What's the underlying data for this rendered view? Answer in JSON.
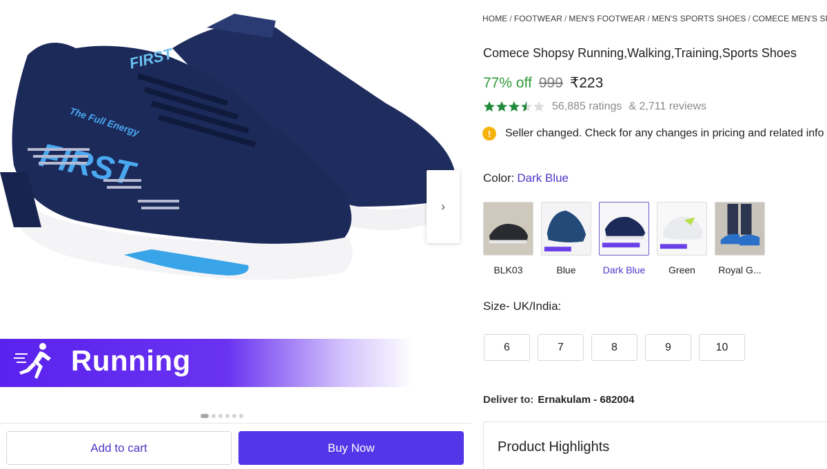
{
  "gallery": {
    "banner_text": "Running",
    "next_icon": "chevron-right-icon",
    "dot_count": 6,
    "active_dot": 0,
    "shoe_print_text": "FIRST",
    "shoe_tagline": "The Full Energy"
  },
  "actions": {
    "add_to_cart": "Add to cart",
    "buy_now": "Buy Now"
  },
  "breadcrumb": [
    "HOME",
    "FOOTWEAR",
    "MEN'S FOOTWEAR",
    "MEN'S SPORTS SHOES",
    "COMECE MEN'S SP"
  ],
  "product": {
    "title": "Comece Shopsy Running,Walking,Training,Sports Shoes",
    "discount": "77% off",
    "mrp": "999",
    "price": "₹223",
    "rating_stars": 3.5,
    "ratings": "56,885 ratings",
    "reviews": "& 2,711 reviews",
    "notice": "Seller changed. Check for any changes in pricing and related info"
  },
  "color": {
    "label": "Color:",
    "selected": "Dark Blue",
    "options": [
      {
        "name": "BLK03"
      },
      {
        "name": "Blue"
      },
      {
        "name": "Dark Blue"
      },
      {
        "name": "Green"
      },
      {
        "name": "Royal G..."
      }
    ]
  },
  "size": {
    "label": "Size- UK/India:",
    "options": [
      "6",
      "7",
      "8",
      "9",
      "10"
    ]
  },
  "delivery": {
    "label": "Deliver to:",
    "location": "Ernakulam - 682004"
  },
  "highlights": {
    "heading": "Product Highlights"
  },
  "colors": {
    "accent": "#5236e8",
    "discount_green": "#2f9a3a",
    "star_green": "#1f8a3a",
    "shoe_navy": "#1c2a5a",
    "sole_blue": "#3aa4e8"
  }
}
